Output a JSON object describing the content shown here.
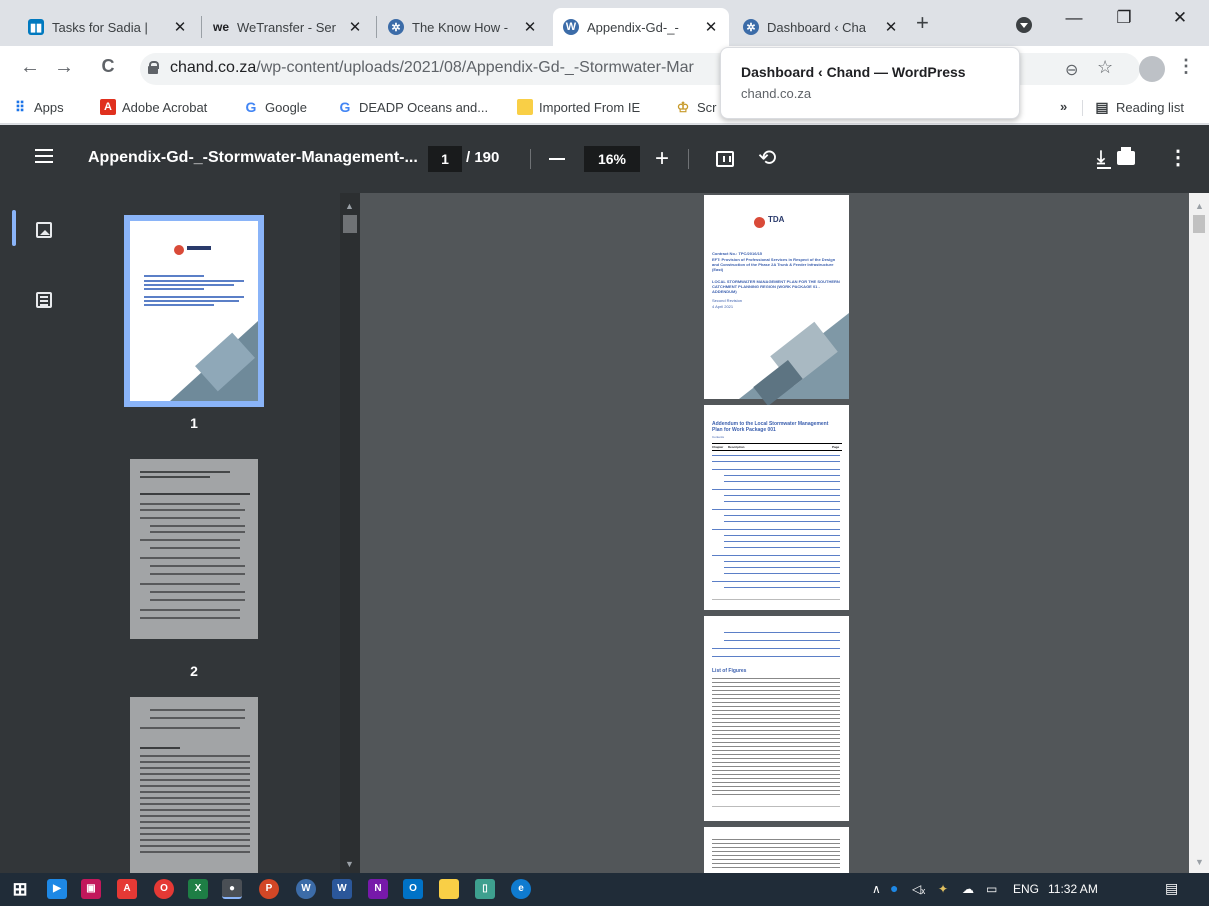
{
  "tabs": [
    {
      "title": "Tasks for Sadia |",
      "icon": "trello-icon",
      "active": false
    },
    {
      "title": "WeTransfer - Ser",
      "icon": "wetransfer-icon",
      "active": false
    },
    {
      "title": "The Know How -",
      "icon": "knowhow-icon",
      "active": false
    },
    {
      "title": "Appendix-Gd-_-",
      "icon": "wordpress-icon",
      "active": true
    },
    {
      "title": "Dashboard ‹ Cha",
      "icon": "knowhow-icon",
      "active": false
    }
  ],
  "omnibox": {
    "host": "chand.co.za",
    "path": "/wp-content/uploads/2021/08/Appendix-Gd-_-Stormwater-Mar"
  },
  "bookmarks": [
    {
      "label": "Apps",
      "icon": "apps-grid-icon"
    },
    {
      "label": "Adobe Acrobat",
      "icon": "acrobat-icon"
    },
    {
      "label": "Google",
      "icon": "google-icon"
    },
    {
      "label": "DEADP Oceans and...",
      "icon": "google-icon"
    },
    {
      "label": "Imported From IE",
      "icon": "folder-icon"
    },
    {
      "label": "Scr",
      "icon": "coat-of-arms-icon"
    }
  ],
  "bookmarks_more": "»",
  "reading_list": "Reading list",
  "tooltip": {
    "title": "Dashboard ‹ Chand — WordPress",
    "url": "chand.co.za"
  },
  "pdf": {
    "title": "Appendix-Gd-_-Stormwater-Management-...",
    "page": "1",
    "total": "/ 190",
    "zoom": "16%"
  },
  "thumbnails": [
    {
      "num": "1"
    },
    {
      "num": "2"
    }
  ],
  "doc_page1": {
    "logo": "TDA",
    "contract": "Contract No.: TPC/2016/15",
    "project": "EFT: Provision of Professional Services in Respect of the Design and Construction of the Phase 2A Trunk & Feeder Infrastructure (East)",
    "heading": "LOCAL STORMWATER MANAGEMENT PLAN FOR THE SOUTHERN CATCHMENT PLANNING REGION (WORK PACKAGE 01 - ADDENDUM)",
    "rev": "Second Revision",
    "date": "4 April 2021"
  },
  "doc_page2": {
    "title": "Addendum to the Local Stormwater Management Plan for Work Package 001",
    "contents": "Contents",
    "chapter": "Chapter",
    "description": "Description",
    "page": "Page"
  },
  "doc_page3": {
    "list_title": "List of Figures"
  },
  "taskbar": {
    "lang": "ENG",
    "time": "11:32 AM"
  }
}
